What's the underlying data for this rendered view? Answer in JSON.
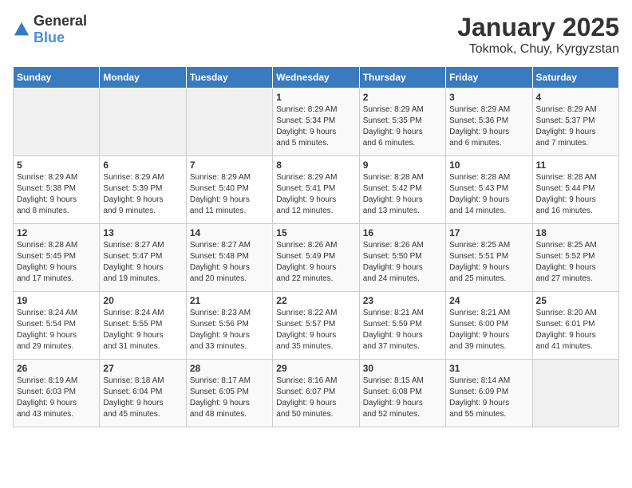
{
  "header": {
    "logo_general": "General",
    "logo_blue": "Blue",
    "month_title": "January 2025",
    "location": "Tokmok, Chuy, Kyrgyzstan"
  },
  "weekdays": [
    "Sunday",
    "Monday",
    "Tuesday",
    "Wednesday",
    "Thursday",
    "Friday",
    "Saturday"
  ],
  "weeks": [
    [
      {
        "day": "",
        "info": ""
      },
      {
        "day": "",
        "info": ""
      },
      {
        "day": "",
        "info": ""
      },
      {
        "day": "1",
        "info": "Sunrise: 8:29 AM\nSunset: 5:34 PM\nDaylight: 9 hours\nand 5 minutes."
      },
      {
        "day": "2",
        "info": "Sunrise: 8:29 AM\nSunset: 5:35 PM\nDaylight: 9 hours\nand 6 minutes."
      },
      {
        "day": "3",
        "info": "Sunrise: 8:29 AM\nSunset: 5:36 PM\nDaylight: 9 hours\nand 6 minutes."
      },
      {
        "day": "4",
        "info": "Sunrise: 8:29 AM\nSunset: 5:37 PM\nDaylight: 9 hours\nand 7 minutes."
      }
    ],
    [
      {
        "day": "5",
        "info": "Sunrise: 8:29 AM\nSunset: 5:38 PM\nDaylight: 9 hours\nand 8 minutes."
      },
      {
        "day": "6",
        "info": "Sunrise: 8:29 AM\nSunset: 5:39 PM\nDaylight: 9 hours\nand 9 minutes."
      },
      {
        "day": "7",
        "info": "Sunrise: 8:29 AM\nSunset: 5:40 PM\nDaylight: 9 hours\nand 11 minutes."
      },
      {
        "day": "8",
        "info": "Sunrise: 8:29 AM\nSunset: 5:41 PM\nDaylight: 9 hours\nand 12 minutes."
      },
      {
        "day": "9",
        "info": "Sunrise: 8:28 AM\nSunset: 5:42 PM\nDaylight: 9 hours\nand 13 minutes."
      },
      {
        "day": "10",
        "info": "Sunrise: 8:28 AM\nSunset: 5:43 PM\nDaylight: 9 hours\nand 14 minutes."
      },
      {
        "day": "11",
        "info": "Sunrise: 8:28 AM\nSunset: 5:44 PM\nDaylight: 9 hours\nand 16 minutes."
      }
    ],
    [
      {
        "day": "12",
        "info": "Sunrise: 8:28 AM\nSunset: 5:45 PM\nDaylight: 9 hours\nand 17 minutes."
      },
      {
        "day": "13",
        "info": "Sunrise: 8:27 AM\nSunset: 5:47 PM\nDaylight: 9 hours\nand 19 minutes."
      },
      {
        "day": "14",
        "info": "Sunrise: 8:27 AM\nSunset: 5:48 PM\nDaylight: 9 hours\nand 20 minutes."
      },
      {
        "day": "15",
        "info": "Sunrise: 8:26 AM\nSunset: 5:49 PM\nDaylight: 9 hours\nand 22 minutes."
      },
      {
        "day": "16",
        "info": "Sunrise: 8:26 AM\nSunset: 5:50 PM\nDaylight: 9 hours\nand 24 minutes."
      },
      {
        "day": "17",
        "info": "Sunrise: 8:25 AM\nSunset: 5:51 PM\nDaylight: 9 hours\nand 25 minutes."
      },
      {
        "day": "18",
        "info": "Sunrise: 8:25 AM\nSunset: 5:52 PM\nDaylight: 9 hours\nand 27 minutes."
      }
    ],
    [
      {
        "day": "19",
        "info": "Sunrise: 8:24 AM\nSunset: 5:54 PM\nDaylight: 9 hours\nand 29 minutes."
      },
      {
        "day": "20",
        "info": "Sunrise: 8:24 AM\nSunset: 5:55 PM\nDaylight: 9 hours\nand 31 minutes."
      },
      {
        "day": "21",
        "info": "Sunrise: 8:23 AM\nSunset: 5:56 PM\nDaylight: 9 hours\nand 33 minutes."
      },
      {
        "day": "22",
        "info": "Sunrise: 8:22 AM\nSunset: 5:57 PM\nDaylight: 9 hours\nand 35 minutes."
      },
      {
        "day": "23",
        "info": "Sunrise: 8:21 AM\nSunset: 5:59 PM\nDaylight: 9 hours\nand 37 minutes."
      },
      {
        "day": "24",
        "info": "Sunrise: 8:21 AM\nSunset: 6:00 PM\nDaylight: 9 hours\nand 39 minutes."
      },
      {
        "day": "25",
        "info": "Sunrise: 8:20 AM\nSunset: 6:01 PM\nDaylight: 9 hours\nand 41 minutes."
      }
    ],
    [
      {
        "day": "26",
        "info": "Sunrise: 8:19 AM\nSunset: 6:03 PM\nDaylight: 9 hours\nand 43 minutes."
      },
      {
        "day": "27",
        "info": "Sunrise: 8:18 AM\nSunset: 6:04 PM\nDaylight: 9 hours\nand 45 minutes."
      },
      {
        "day": "28",
        "info": "Sunrise: 8:17 AM\nSunset: 6:05 PM\nDaylight: 9 hours\nand 48 minutes."
      },
      {
        "day": "29",
        "info": "Sunrise: 8:16 AM\nSunset: 6:07 PM\nDaylight: 9 hours\nand 50 minutes."
      },
      {
        "day": "30",
        "info": "Sunrise: 8:15 AM\nSunset: 6:08 PM\nDaylight: 9 hours\nand 52 minutes."
      },
      {
        "day": "31",
        "info": "Sunrise: 8:14 AM\nSunset: 6:09 PM\nDaylight: 9 hours\nand 55 minutes."
      },
      {
        "day": "",
        "info": ""
      }
    ]
  ]
}
